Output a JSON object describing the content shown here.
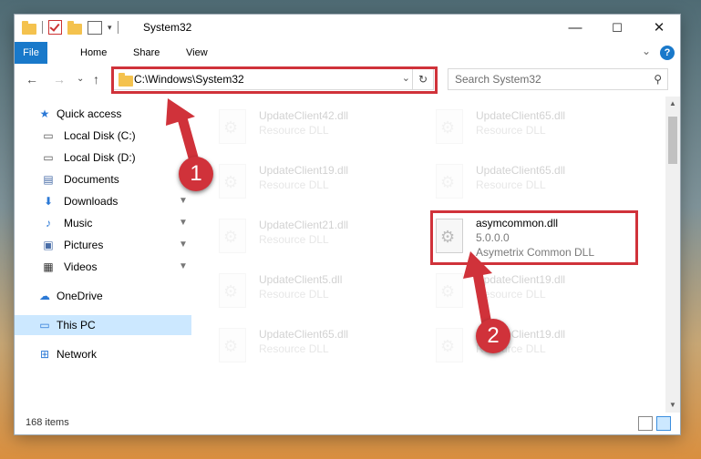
{
  "window": {
    "title": "System32",
    "minimize": "—",
    "maximize": "☐",
    "close": "✕"
  },
  "ribbon": {
    "tabs": [
      "File",
      "Home",
      "Share",
      "View"
    ],
    "help": "?",
    "expand": "⌄"
  },
  "address": {
    "back": "←",
    "forward": "→",
    "recent": "⌄",
    "up": "↑",
    "path": "C:\\Windows\\System32",
    "dropdown": "⌄",
    "refresh": "↻"
  },
  "search": {
    "placeholder": "Search System32",
    "icon": "⚲"
  },
  "nav": {
    "quick_access": "Quick access",
    "items": [
      {
        "label": "Local Disk (C:)",
        "icon": "drive-icon",
        "pinned": false
      },
      {
        "label": "Local Disk (D:)",
        "icon": "drive-icon",
        "pinned": false
      },
      {
        "label": "Documents",
        "icon": "documents-icon",
        "pinned": true
      },
      {
        "label": "Downloads",
        "icon": "downloads-icon",
        "pinned": true
      },
      {
        "label": "Music",
        "icon": "music-icon",
        "pinned": true
      },
      {
        "label": "Pictures",
        "icon": "pictures-icon",
        "pinned": true
      },
      {
        "label": "Videos",
        "icon": "videos-icon",
        "pinned": true
      }
    ],
    "onedrive": "OneDrive",
    "this_pc": "This PC",
    "network": "Network",
    "pin": "📌"
  },
  "files": {
    "left": [
      {
        "name": "UpdateClient42.dll",
        "desc": "Resource DLL"
      },
      {
        "name": "UpdateClient19.dll",
        "desc": "Resource DLL"
      },
      {
        "name": "UpdateClient21.dll",
        "desc": "Resource DLL"
      },
      {
        "name": "UpdateClient5.dll",
        "desc": "Resource DLL"
      },
      {
        "name": "UpdateClient65.dll",
        "desc": "Resource DLL"
      }
    ],
    "right": [
      {
        "name": "UpdateClient65.dll",
        "desc": "Resource DLL"
      },
      {
        "name": "UpdateClient65.dll",
        "desc": "Resource DLL"
      },
      {
        "name": "UpdateClient19.dll",
        "desc": "Resource DLL"
      },
      {
        "name": "UpdateClient19.dll",
        "desc": "Resource DLL"
      }
    ],
    "highlighted": {
      "name": "asymcommon.dll",
      "version": "5.0.0.0",
      "desc": "Asymetrix Common DLL"
    }
  },
  "status": {
    "count": "168 items"
  },
  "annotations": {
    "step1": "1",
    "step2": "2",
    "accent": "#d0323a"
  }
}
